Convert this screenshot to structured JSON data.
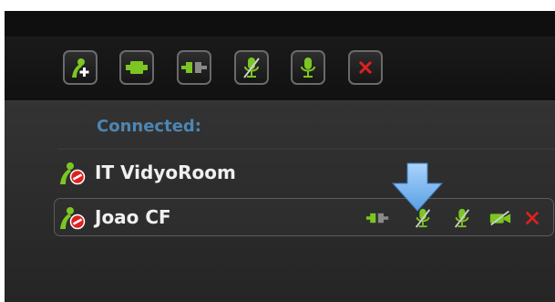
{
  "toolbar": {
    "buttons": [
      {
        "id": "add-participant",
        "icon": "add-user-icon"
      },
      {
        "id": "connect",
        "icon": "plug-connected-icon"
      },
      {
        "id": "disconnect",
        "icon": "plug-disconnected-icon"
      },
      {
        "id": "mute-microphone",
        "icon": "microphone-muted-icon"
      },
      {
        "id": "microphone",
        "icon": "microphone-icon"
      },
      {
        "id": "close",
        "icon": "close-x-icon"
      }
    ]
  },
  "participants": {
    "section_label": "Connected:",
    "items": [
      {
        "name": "IT VidyoRoom",
        "selected": false
      },
      {
        "name": "Joao CF",
        "selected": true
      }
    ]
  },
  "colors": {
    "accent_blue": "#4d86b3",
    "icon_green": "#7cc623",
    "close_red": "#e02020",
    "arrow_blue": "#7ab8f2"
  }
}
